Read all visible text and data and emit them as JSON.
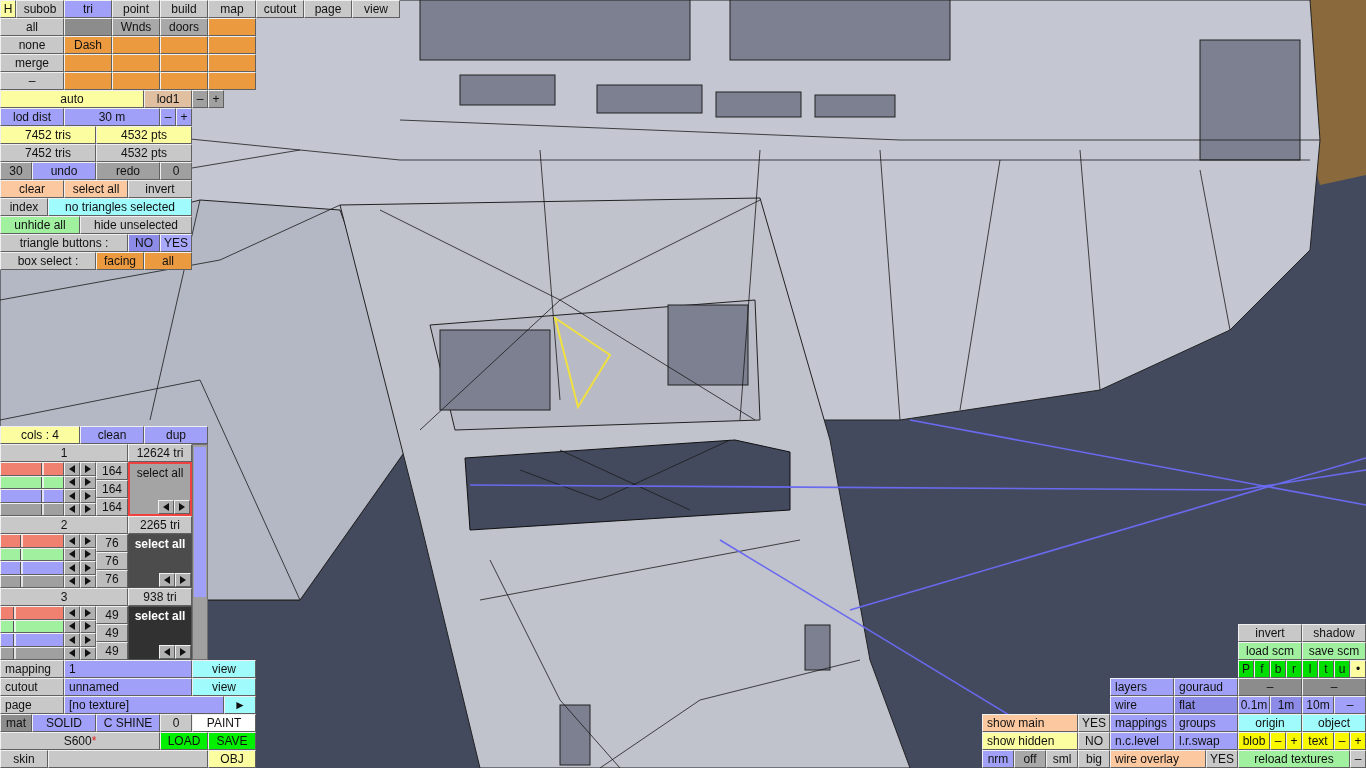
{
  "top_panel": [
    [
      {
        "label": "H",
        "color": "#fcfca0"
      },
      {
        "label": "subob",
        "color": "#c8c8c8"
      },
      {
        "label": "tri",
        "color": "#a0a0f8"
      },
      {
        "label": "point",
        "color": "#c8c8c8"
      },
      {
        "label": "build",
        "color": "#c8c8c8"
      },
      {
        "label": "map",
        "color": "#c8c8c8"
      },
      {
        "label": "cutout",
        "color": "#c8c8c8"
      },
      {
        "label": "page",
        "color": "#c8c8c8"
      },
      {
        "label": "view",
        "color": "#c8c8c8"
      }
    ],
    [
      {
        "label": "all",
        "color": "#c8c8c8"
      },
      {
        "color": "#8c8c8c"
      },
      {
        "label": "Wnds",
        "color": "#a8a8a8"
      },
      {
        "label": "doors",
        "color": "#a8a8a8"
      },
      {
        "color": "#ec9a40"
      }
    ],
    [
      {
        "label": "none",
        "color": "#c8c8c8"
      },
      {
        "label": "Dash",
        "color": "#ec9a40"
      },
      {
        "color": "#ec9a40"
      },
      {
        "color": "#ec9a40"
      },
      {
        "color": "#ec9a40"
      }
    ],
    [
      {
        "label": "merge",
        "color": "#c8c8c8"
      },
      {
        "color": "#ec9a40"
      },
      {
        "color": "#ec9a40"
      },
      {
        "color": "#ec9a40"
      },
      {
        "color": "#ec9a40"
      }
    ],
    [
      {
        "label": "–",
        "color": "#c8c8c8"
      },
      {
        "color": "#ec9a40"
      },
      {
        "color": "#ec9a40"
      },
      {
        "color": "#ec9a40"
      },
      {
        "color": "#ec9a40"
      }
    ],
    [
      {
        "label": "auto",
        "color": "#fcfca0"
      },
      {
        "label": "lod1",
        "color": "#e0c0a0"
      },
      {
        "label": "–",
        "color": "#a0a0a0"
      },
      {
        "label": "+",
        "color": "#a0a0a0"
      }
    ],
    [
      {
        "label": "lod dist",
        "color": "#a0a0f8"
      },
      {
        "label": "30 m",
        "color": "#a0a0f8"
      },
      {
        "label": "–",
        "color": "#a0a0f8"
      },
      {
        "label": "+",
        "color": "#a0a0f8"
      }
    ],
    [
      {
        "label": "7452 tris",
        "color": "#fcfca0"
      },
      {
        "label": "4532 pts",
        "color": "#fcfca0"
      }
    ],
    [
      {
        "label": "7452 tris",
        "color": "#c8c8c8"
      },
      {
        "label": "4532 pts",
        "color": "#c8c8c8"
      }
    ],
    [
      {
        "label": "30",
        "color": "#a0a0a0"
      },
      {
        "label": "undo",
        "color": "#a0a0f8"
      },
      {
        "label": "redo",
        "color": "#a0a0a0"
      },
      {
        "label": "0",
        "color": "#a0a0a0"
      }
    ],
    [
      {
        "label": "clear",
        "color": "#fcc8a0"
      },
      {
        "label": "select all",
        "color": "#fcc8a0"
      },
      {
        "label": "invert",
        "color": "#c8c8c8"
      }
    ],
    [
      {
        "label": "index",
        "color": "#c8c8c8"
      },
      {
        "label": "no triangles selected",
        "color": "#a0fcfc"
      }
    ],
    [
      {
        "label": "unhide all",
        "color": "#a0f0a0"
      },
      {
        "label": "hide unselected",
        "color": "#c8c8c8"
      }
    ],
    [
      {
        "label": "triangle buttons :",
        "color": "#c8c8c8"
      },
      {
        "label": "NO",
        "color": "#8c8ce8"
      },
      {
        "label": "YES",
        "color": "#a8a8fc"
      }
    ],
    [
      {
        "label": "box select :",
        "color": "#c8c8c8"
      },
      {
        "label": "facing",
        "color": "#ec9a40"
      },
      {
        "label": "all",
        "color": "#ec9a40"
      }
    ]
  ],
  "colors_header": [
    {
      "label": "cols : 4",
      "color": "#fcfca0"
    },
    {
      "label": "clean",
      "color": "#a0a0f8"
    },
    {
      "label": "dup",
      "color": "#a0a0f8"
    }
  ],
  "color_groups": [
    {
      "number": "1",
      "tris": "12624 tri",
      "selected": true,
      "color": "#a4a4a4",
      "select_label": "select all",
      "values": [
        "164",
        "164",
        "164"
      ],
      "channels": [
        {
          "color": "#f08070",
          "level": 0.64
        },
        {
          "color": "#a0f0a0",
          "level": 0.64
        },
        {
          "color": "#a0a0f8",
          "level": 0.64
        },
        {
          "color": "#a0a0a0",
          "level": 0.64
        }
      ]
    },
    {
      "number": "2",
      "tris": "2265 tri",
      "selected": false,
      "color": "#4c4c4c",
      "select_label": "select all",
      "values": [
        "76",
        "76",
        "76"
      ],
      "channels": [
        {
          "color": "#f08070",
          "level": 0.3
        },
        {
          "color": "#a0f0a0",
          "level": 0.3
        },
        {
          "color": "#a0a0f8",
          "level": 0.3
        },
        {
          "color": "#a0a0a0",
          "level": 0.3
        }
      ]
    },
    {
      "number": "3",
      "tris": "938 tri",
      "selected": false,
      "color": "#313131",
      "select_label": "select all",
      "values": [
        "49",
        "49",
        "49"
      ],
      "channels": [
        {
          "color": "#f08070",
          "level": 0.19
        },
        {
          "color": "#a0f0a0",
          "level": 0.19
        },
        {
          "color": "#a0a0f8",
          "level": 0.19
        },
        {
          "color": "#a0a0a0",
          "level": 0.19
        }
      ]
    }
  ],
  "lower_panel": [
    [
      {
        "label": "mapping",
        "color": "#c8c8c8"
      },
      {
        "label": "1",
        "color": "#a0a0f8"
      },
      {
        "label": "view",
        "color": "#a0fcfc"
      }
    ],
    [
      {
        "label": "cutout",
        "color": "#c8c8c8"
      },
      {
        "label": "unnamed",
        "color": "#a0a0f8"
      },
      {
        "label": "view",
        "color": "#a0fcfc"
      }
    ],
    [
      {
        "label": "page",
        "color": "#c8c8c8"
      },
      {
        "label": "[no texture]",
        "color": "#a0a0f8"
      },
      {
        "label": "►",
        "color": "#a0fcfc"
      }
    ],
    [
      {
        "label": "mat",
        "color": "#8c8c8c"
      },
      {
        "label": "SOLID",
        "color": "#a0a0f8"
      },
      {
        "label": "C SHINE",
        "color": "#a0a0f8"
      },
      {
        "label": "0",
        "color": "#c8c8c8"
      },
      {
        "label": "PAINT",
        "color": "#ffffff"
      }
    ],
    [
      {
        "label": "S600",
        "mark": "*",
        "color": "#c8c8c8"
      },
      {
        "label": "LOAD",
        "color": "#00f000"
      },
      {
        "label": "SAVE",
        "color": "#00f000"
      }
    ],
    [
      {
        "label": "skin",
        "color": "#c8c8c8"
      },
      {
        "color": "#c8c8c8"
      },
      {
        "label": "OBJ",
        "color": "#fcfca0"
      }
    ]
  ],
  "view_left": [
    [
      {
        "label": "show main",
        "color": "#fcc8a0"
      },
      {
        "label": "YES",
        "color": "#c8c8c8"
      }
    ],
    [
      {
        "label": "show hidden",
        "color": "#fcfca0"
      },
      {
        "label": "NO",
        "color": "#c8c8c8"
      }
    ],
    [
      {
        "label": "nrm",
        "color": "#a0a0f8"
      },
      {
        "label": "off",
        "color": "#a8a8a8"
      },
      {
        "label": "sml",
        "color": "#c8c8c8"
      },
      {
        "label": "big",
        "color": "#c8c8c8"
      }
    ]
  ],
  "view_middle": [
    [
      {
        "label": "layers",
        "color": "#a0a0f8"
      },
      {
        "label": "gouraud",
        "color": "#a0a0f8"
      }
    ],
    [
      {
        "label": "wire",
        "color": "#a0a0f8"
      },
      {
        "label": "flat",
        "color": "#8c8ce8"
      }
    ],
    [
      {
        "label": "mappings",
        "color": "#a0a0f8"
      },
      {
        "label": "groups",
        "color": "#a0a0f8"
      }
    ],
    [
      {
        "label": "n.c.level",
        "color": "#a0a0f8"
      },
      {
        "label": "l.r.swap",
        "color": "#a0a0f8"
      }
    ],
    [
      {
        "label": "wire overlay",
        "color": "#fcc8a0"
      },
      {
        "label": "YES",
        "color": "#c8c8c8"
      }
    ]
  ],
  "view_right": [
    [
      {
        "label": "invert",
        "color": "#c8c8c8"
      },
      {
        "label": "shadow",
        "color": "#c8c8c8"
      }
    ],
    [
      {
        "label": "load scm",
        "color": "#a0f0a0"
      },
      {
        "label": "save scm",
        "color": "#a0f0a0"
      }
    ],
    [
      {
        "label": "P",
        "color": "#00e000"
      },
      {
        "label": "f",
        "color": "#00e000"
      },
      {
        "label": "b",
        "color": "#00e000"
      },
      {
        "label": "r",
        "color": "#00e000"
      },
      {
        "label": "l",
        "color": "#00e000"
      },
      {
        "label": "t",
        "color": "#00e000"
      },
      {
        "label": "u",
        "color": "#00e000"
      },
      {
        "label": "•",
        "color": "#fcfca0"
      }
    ],
    [
      {
        "label": "–",
        "color": "#8c8c8c"
      },
      {
        "label": "–",
        "color": "#8c8c8c"
      }
    ],
    [
      {
        "label": "0.1m",
        "color": "#a0a0f8"
      },
      {
        "label": "1m",
        "color": "#8c8ce8"
      },
      {
        "label": "10m",
        "color": "#a0a0f8"
      },
      {
        "label": "–",
        "color": "#a0a0f8"
      }
    ],
    [
      {
        "label": "origin",
        "color": "#a0fcfc"
      },
      {
        "label": "object",
        "color": "#a0fcfc"
      }
    ],
    [
      {
        "label": "blob",
        "color": "#f8f800"
      },
      {
        "label": "–",
        "color": "#f8f800"
      },
      {
        "label": "+",
        "color": "#f8f800"
      },
      {
        "label": "text",
        "color": "#f8f800"
      },
      {
        "label": "–",
        "color": "#f8f800"
      },
      {
        "label": "+",
        "color": "#f8f800"
      }
    ],
    [
      {
        "label": "reload textures",
        "color": "#a0f0a0"
      },
      {
        "label": "–",
        "color": "#c8c8c8"
      }
    ]
  ]
}
